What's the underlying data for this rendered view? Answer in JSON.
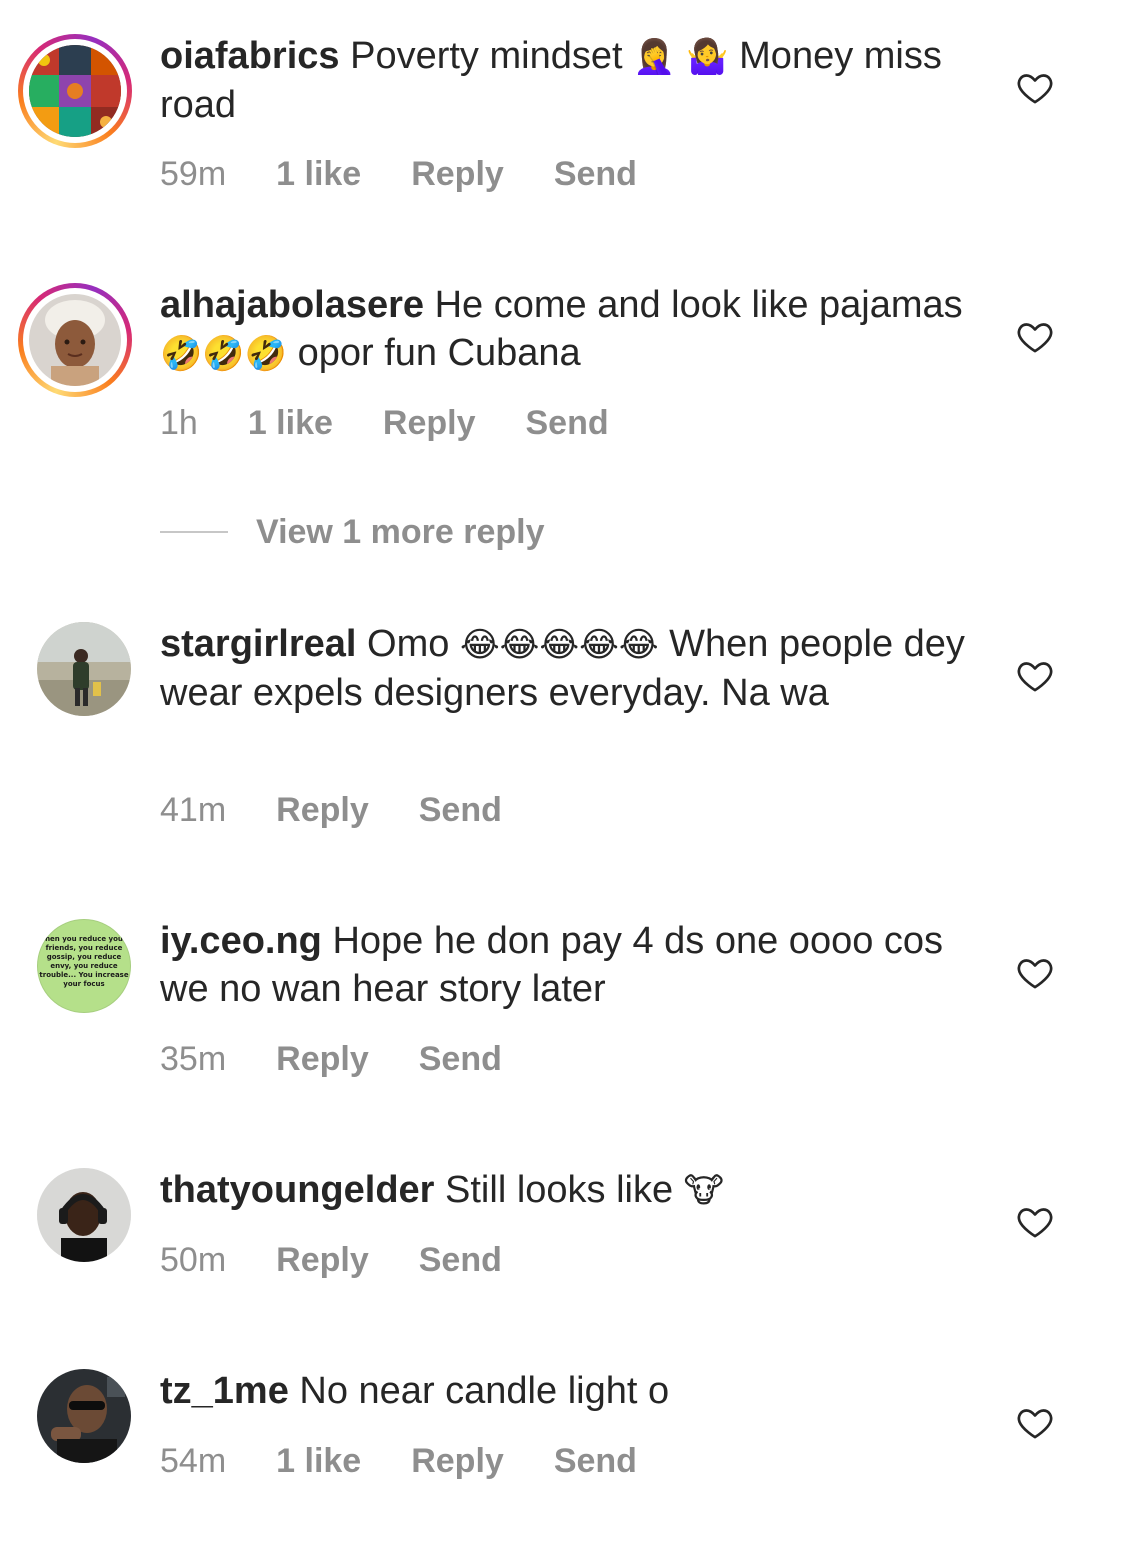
{
  "comments": [
    {
      "username": "oiafabrics",
      "text_before": "Poverty mindset",
      "emoji": "🤦‍♀️ 🤷‍♀️",
      "text_after": "Money miss road",
      "time": "59m",
      "likes": "1 like",
      "reply": "Reply",
      "send": "Send",
      "avatar_icon": "patchwork-fabric-avatar",
      "story_ring": true
    },
    {
      "username": "alhajabolasere",
      "text_before": "He come and look like pajamas",
      "emoji": "🤣🤣🤣",
      "text_after": "opor fun Cubana",
      "time": "1h",
      "likes": "1 like",
      "reply": "Reply",
      "send": "Send",
      "avatar_icon": "woman-headwrap-avatar",
      "story_ring": true
    },
    {
      "username": "stargirlreal",
      "text_before": "Omo",
      "emoji": "😂😂😂😂😂",
      "text_after": "When people dey wear expels designers everyday. Na wa",
      "time": "41m",
      "reply": "Reply",
      "send": "Send",
      "avatar_icon": "person-outdoor-avatar",
      "story_ring": false
    },
    {
      "username": "iy.ceo.ng",
      "text_before": "Hope he don pay 4 ds one oooo cos we no wan hear story later",
      "time": "35m",
      "reply": "Reply",
      "send": "Send",
      "avatar_icon": "quote-text-avatar",
      "story_ring": false
    },
    {
      "username": "thatyoungelder",
      "text_before": "Still looks like",
      "emoji": "🐮",
      "time": "50m",
      "reply": "Reply",
      "send": "Send",
      "avatar_icon": "man-headphones-avatar",
      "story_ring": false
    },
    {
      "username": "tz_1me",
      "text_before": "No near candle light o",
      "time": "54m",
      "likes": "1 like",
      "reply": "Reply",
      "send": "Send",
      "avatar_icon": "man-sunglasses-avatar",
      "story_ring": false
    }
  ],
  "view_more_reply": "View 1 more reply",
  "avatar_note": "hen you reduce you friends, you reduce gossip, you reduce envy, you reduce trouble... You increase your focus",
  "colors": {
    "text": "#262626",
    "meta": "#8e8e8e",
    "story_ring": [
      "#feda75",
      "#fa7e1e",
      "#d62976",
      "#962fbf"
    ],
    "note_avatar_bg": "#b5e08a"
  },
  "icons": {
    "like": "heart-outline-icon"
  }
}
